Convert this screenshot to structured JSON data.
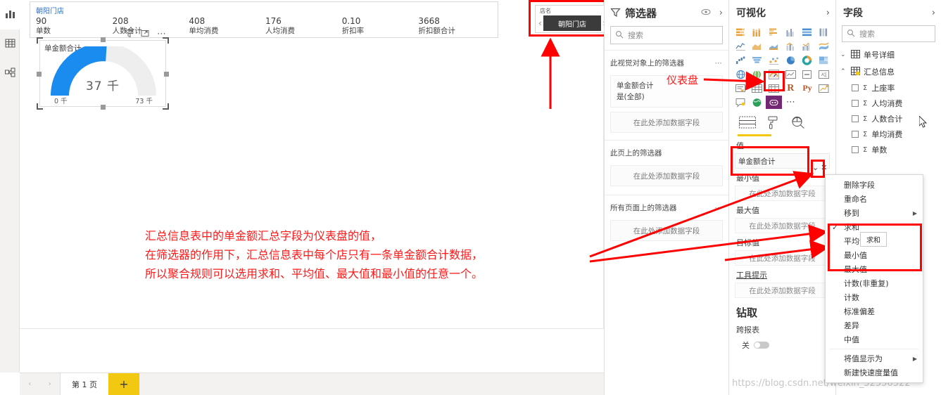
{
  "rail": {
    "items": [
      {
        "name": "report-view",
        "icon": "bar-chart-icon"
      },
      {
        "name": "data-view",
        "icon": "table-icon"
      },
      {
        "name": "model-view",
        "icon": "relationship-icon"
      }
    ]
  },
  "canvas": {
    "kpi_card": {
      "title": "朝阳门店",
      "columns": [
        {
          "value": "90",
          "label": "单数"
        },
        {
          "value": "208",
          "label": "人数合计"
        },
        {
          "value": "408",
          "label": "单均消费"
        },
        {
          "value": "176",
          "label": "人均消费"
        },
        {
          "value": "0.10",
          "label": "折扣率"
        },
        {
          "value": "3668",
          "label": "折扣额合计"
        }
      ]
    },
    "gauge": {
      "title": "单金额合计",
      "value_text": "37 千",
      "min_text": "0 千",
      "max_text": "73 千",
      "arc_color": "#1a8cf0",
      "track_color": "#eeeeee",
      "percent": 51
    },
    "slicer": {
      "caption": "店名",
      "selected": "朝阳门店",
      "prev_icon": "chevron-left-icon",
      "next_icon": "chevron-right-icon"
    },
    "annotation_lines": [
      "汇总信息表中的单金额汇总字段为仪表盘的值，",
      "在筛选器的作用下，汇总信息表中每个店只有一条单金额合计数据，",
      "所以聚合规则可以选用求和、平均值、最大值和最小值的任意一个。"
    ],
    "gauge_callout": "仪表盘"
  },
  "pagebar": {
    "page_tab": "第 1 页",
    "add_page": "+",
    "add_page_color": "#f2c811"
  },
  "filters": {
    "title": "筛选器",
    "filter_icon": "funnel-icon",
    "eye_icon": "eye-icon",
    "expand_icon": "chevron-right-icon",
    "search_placeholder": "搜索",
    "search_icon": "search-icon",
    "sections": [
      {
        "title": "此视觉对象上的筛选器",
        "card": {
          "field": "单金额合计",
          "state": "是(全部)"
        },
        "dropzone": "在此处添加数据字段"
      },
      {
        "title": "此页上的筛选器",
        "dropzone": "在此处添加数据字段"
      },
      {
        "title": "所有页面上的筛选器",
        "dropzone": "在此处添加数据字段"
      }
    ]
  },
  "visualizations": {
    "title": "可视化",
    "collapse_icon": "chevron-right-icon",
    "gallery_icons": [
      "stacked-bar-chart-icon",
      "stacked-column-chart-icon",
      "clustered-bar-chart-icon",
      "clustered-column-chart-icon",
      "100-stacked-bar-chart-icon",
      "100-stacked-column-chart-icon",
      "line-chart-icon",
      "area-chart-icon",
      "stacked-area-chart-icon",
      "line-stacked-column-icon",
      "line-clustered-column-icon",
      "ribbon-chart-icon",
      "waterfall-chart-icon",
      "funnel-chart-icon",
      "scatter-chart-icon",
      "pie-chart-icon",
      "donut-chart-icon",
      "treemap-icon",
      "map-icon",
      "filled-map-icon",
      "gauge-chart-icon",
      "kpi-icon",
      "card-icon",
      "multi-row-card-icon",
      "slicer-icon",
      "table-icon",
      "matrix-icon",
      "r-script-visual-icon",
      "python-visual-icon",
      "key-influencers-icon",
      "qa-visual-icon",
      "arcgis-map-icon",
      "powerapps-visual-icon",
      "more-options-icon"
    ],
    "selected_visual": "gauge-chart-icon",
    "format_tabs": [
      "fields-icon",
      "format-paint-roller-icon",
      "analytics-magnifier-icon"
    ],
    "wells": [
      {
        "label": "值",
        "field": "单金额合计",
        "chevron_icon": "chevron-down-icon",
        "remove_icon": "close-icon"
      },
      {
        "label": "最小值",
        "dropzone": "在此处添加数据字段"
      },
      {
        "label": "最大值",
        "dropzone": "在此处添加数据字段"
      },
      {
        "label": "目标值",
        "dropzone": "在此处添加数据字段"
      },
      {
        "label": "工具提示",
        "dropzone": "在此处添加数据字段"
      }
    ],
    "drill": {
      "title": "钻取",
      "cross_report_label": "跨报表",
      "toggle_state": "关"
    }
  },
  "fields": {
    "title": "字段",
    "collapse_icon": "chevron-right-icon",
    "search_placeholder": "搜索",
    "search_icon": "search-icon",
    "tables": [
      {
        "name": "单号详细",
        "expanded": false,
        "icon": "table-icon",
        "chevron_icon": "chevron-down-icon",
        "fields": []
      },
      {
        "name": "汇总信息",
        "expanded": true,
        "icon": "table-icon",
        "chevron_icon": "chevron-up-icon",
        "fields": [
          {
            "name": "上座率",
            "aggregate_icon": "sigma-icon",
            "checked": false
          },
          {
            "name": "人均消费",
            "aggregate_icon": "sigma-icon",
            "checked": false
          },
          {
            "name": "人数合计",
            "aggregate_icon": "sigma-icon",
            "checked": false
          },
          {
            "name": "单均消费",
            "aggregate_icon": "sigma-icon",
            "checked": false
          },
          {
            "name": "单数",
            "aggregate_icon": "sigma-icon",
            "checked": false
          }
        ]
      }
    ],
    "obscured_field_fragments": [
      "合计",
      "数",
      "合计"
    ],
    "cursor_icon": "mouse-pointer-icon"
  },
  "context_menu": {
    "items": [
      {
        "label": "删除字段",
        "checked": false,
        "submenu": false
      },
      {
        "label": "重命名",
        "checked": false,
        "submenu": false
      },
      {
        "label": "移到",
        "checked": false,
        "submenu": true
      },
      {
        "label": "求和",
        "checked": true,
        "submenu": false
      },
      {
        "label": "平均值",
        "checked": false,
        "submenu": false
      },
      {
        "label": "最小值",
        "checked": false,
        "submenu": false
      },
      {
        "label": "最大值",
        "checked": false,
        "submenu": false
      },
      {
        "label": "计数(非重复)",
        "checked": false,
        "submenu": false
      },
      {
        "label": "计数",
        "checked": false,
        "submenu": false
      },
      {
        "label": "标准偏差",
        "checked": false,
        "submenu": false
      },
      {
        "label": "差异",
        "checked": false,
        "submenu": false
      },
      {
        "label": "中值",
        "checked": false,
        "submenu": false
      },
      {
        "label": "将值显示为",
        "checked": false,
        "submenu": true
      },
      {
        "label": "新建快速度量值",
        "checked": false,
        "submenu": false
      }
    ],
    "tooltip": "求和"
  },
  "watermark": "https://blog.csdn.net/weixin_52556522",
  "colors": {
    "highlight_red": "#ff0000",
    "annotation_red": "#ff1a1a",
    "accent_yellow": "#f2c811",
    "gauge_blue": "#1a8cf0"
  }
}
